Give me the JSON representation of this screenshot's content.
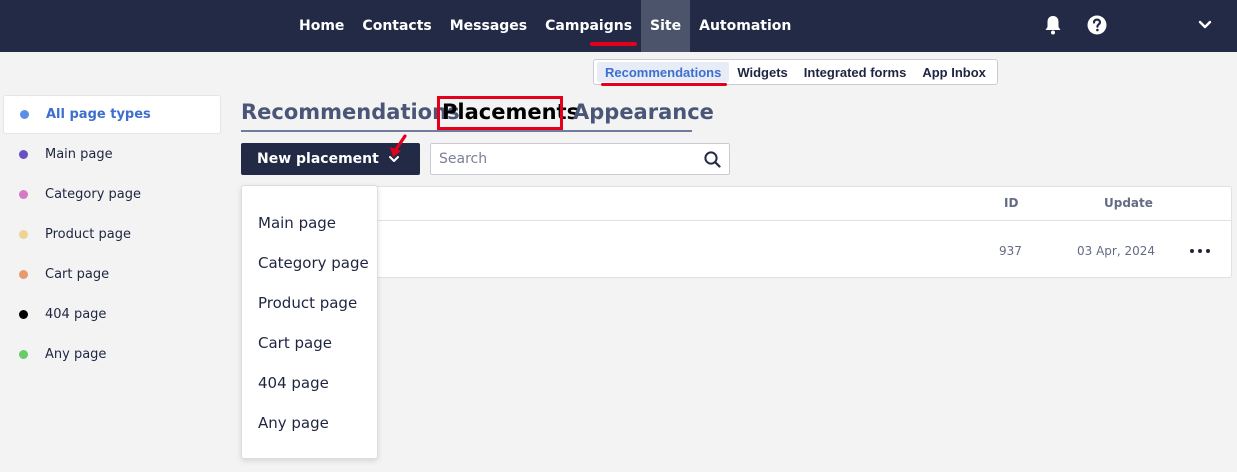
{
  "nav": {
    "items": [
      {
        "label": "Home"
      },
      {
        "label": "Contacts"
      },
      {
        "label": "Messages"
      },
      {
        "label": "Campaigns"
      },
      {
        "label": "Site",
        "active": true
      },
      {
        "label": "Automation"
      }
    ],
    "icons": [
      "bell-icon",
      "help-icon",
      "chevron-down-icon"
    ]
  },
  "subnav": {
    "items": [
      {
        "label": "Recommendations",
        "active": true
      },
      {
        "label": "Widgets"
      },
      {
        "label": "Integrated forms"
      },
      {
        "label": "App Inbox"
      }
    ]
  },
  "sidebar": {
    "items": [
      {
        "label": "All page types",
        "color": "#5b8ee6",
        "active": true
      },
      {
        "label": "Main page",
        "color": "#6a4ec2"
      },
      {
        "label": "Category page",
        "color": "#d47ac7"
      },
      {
        "label": "Product page",
        "color": "#ecd494"
      },
      {
        "label": "Cart page",
        "color": "#e79a6e"
      },
      {
        "label": "404 page",
        "color": "#000000"
      },
      {
        "label": "Any page",
        "color": "#66cc66"
      }
    ]
  },
  "tabs": [
    {
      "label": "Recommendations"
    },
    {
      "label": "Placements",
      "active": true
    },
    {
      "label": "Appearance"
    }
  ],
  "toolbar": {
    "new_button_label": "New placement",
    "search_placeholder": "Search"
  },
  "table": {
    "headers": {
      "id": "ID",
      "update": "Update"
    },
    "rows": [
      {
        "id": "937",
        "update": "03 Apr, 2024"
      }
    ]
  },
  "dropdown": {
    "items": [
      {
        "label": "Main page"
      },
      {
        "label": "Category page"
      },
      {
        "label": "Product page"
      },
      {
        "label": "Cart page"
      },
      {
        "label": "404 page"
      },
      {
        "label": "Any page"
      }
    ]
  },
  "colors": {
    "topbar": "#222a45",
    "accent": "#3d6fcf",
    "highlight": "#e4001b"
  }
}
